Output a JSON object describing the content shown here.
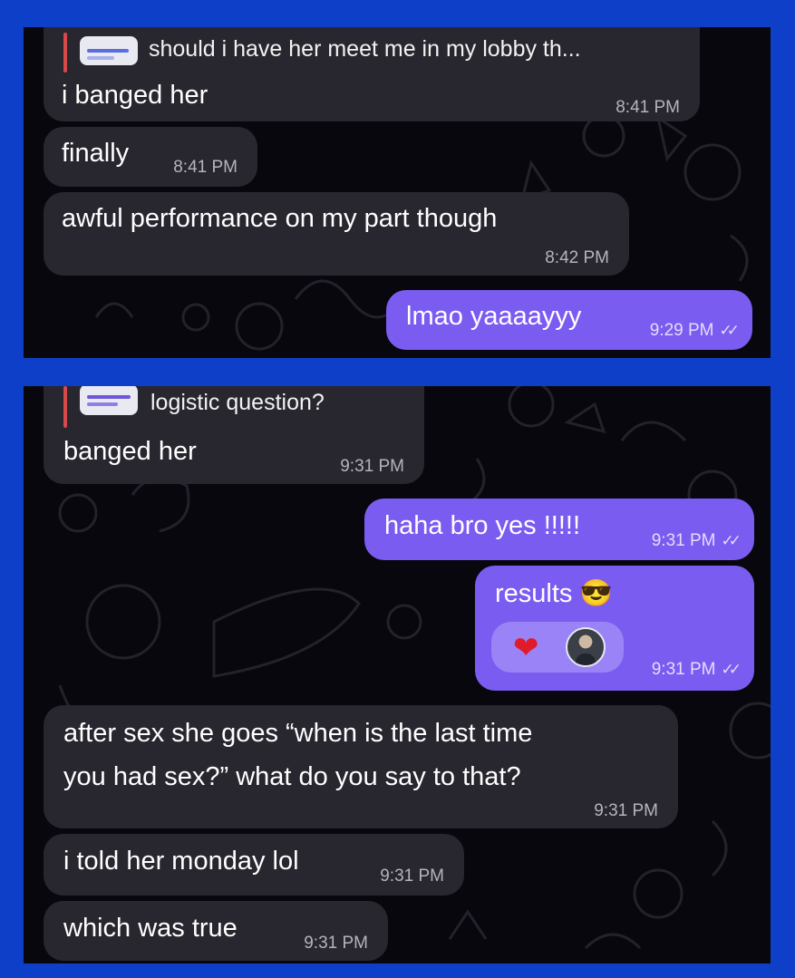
{
  "colors": {
    "frame": "#0d3fc8",
    "chat_background": "#07070d",
    "incoming_bubble": "#28262e",
    "outgoing_bubble": "#7b5cf0",
    "reply_accent": "#d54a4a"
  },
  "top_panel": {
    "reply_preview": {
      "text": "should i have her meet me in my lobby th..."
    },
    "messages": [
      {
        "text": "i banged her",
        "time": "8:41 PM"
      },
      {
        "text": "finally",
        "time": "8:41 PM"
      },
      {
        "text": "awful performance on my part though",
        "time": "8:42 PM"
      },
      {
        "text": "lmao yaaaayyy",
        "time": "9:29 PM",
        "status_icon": "double-check-icon"
      }
    ]
  },
  "bottom_panel": {
    "reply_preview": {
      "text": "logistic question?"
    },
    "messages": [
      {
        "text": "banged her",
        "time": "9:31 PM"
      },
      {
        "text": "haha bro yes !!!!!",
        "time": "9:31 PM",
        "status_icon": "double-check-icon"
      },
      {
        "text": "results 😎",
        "time": "9:31 PM",
        "status_icon": "double-check-icon",
        "reaction": {
          "emoji": "❤",
          "icon": "heart-icon"
        }
      },
      {
        "line1": "after sex she goes “when is the last time",
        "line2": "you had sex?” what do you say to that?",
        "time": "9:31 PM"
      },
      {
        "text": "i told her monday lol",
        "time": "9:31 PM"
      },
      {
        "text": "which was true",
        "time": "9:31 PM"
      }
    ]
  },
  "checkmark_glyph": "✓✓"
}
